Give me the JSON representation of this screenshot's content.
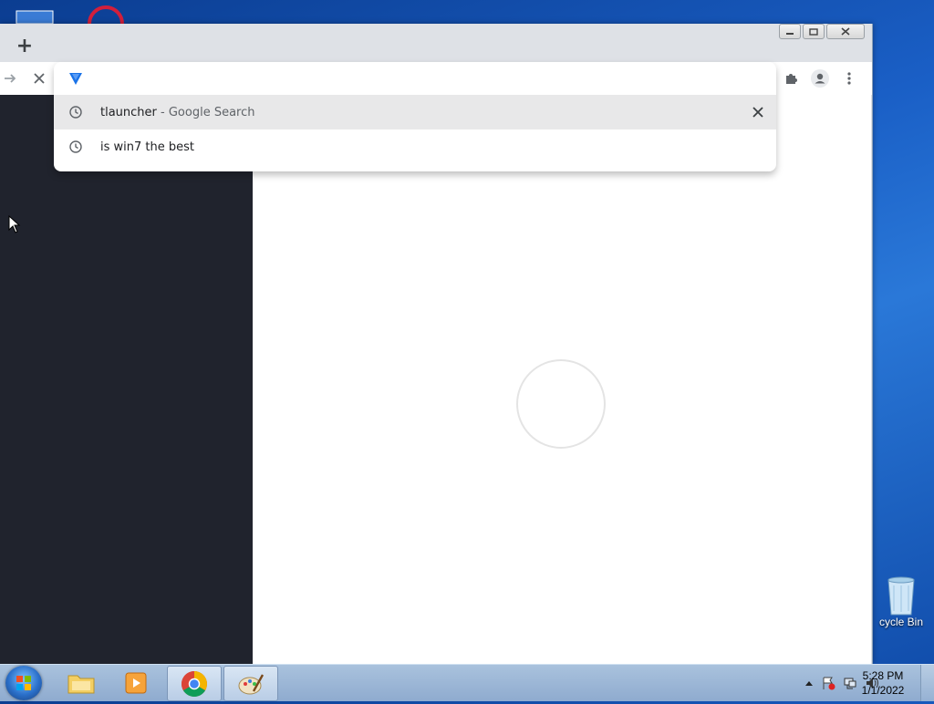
{
  "browser": {
    "new_tab_label": "+",
    "omnibox": {
      "value": "",
      "suggestions": [
        {
          "text": "tlauncher",
          "desc": " - Google Search",
          "icon": "history-icon",
          "removable": true
        },
        {
          "text": "is win7 the best",
          "desc": "",
          "icon": "history-icon",
          "removable": false
        }
      ]
    }
  },
  "desktop": {
    "recycle_bin_label": "cycle Bin"
  },
  "taskbar": {
    "apps": [
      "start-orb",
      "file-explorer-icon",
      "media-player-icon",
      "chrome-icon",
      "paint-icon"
    ],
    "clock_time": "5:28 PM",
    "clock_date": "1/1/2022"
  },
  "colors": {
    "sidebar": "#20232d",
    "selected_suggestion": "#e8e8e9",
    "accent": "#1a73e8"
  }
}
